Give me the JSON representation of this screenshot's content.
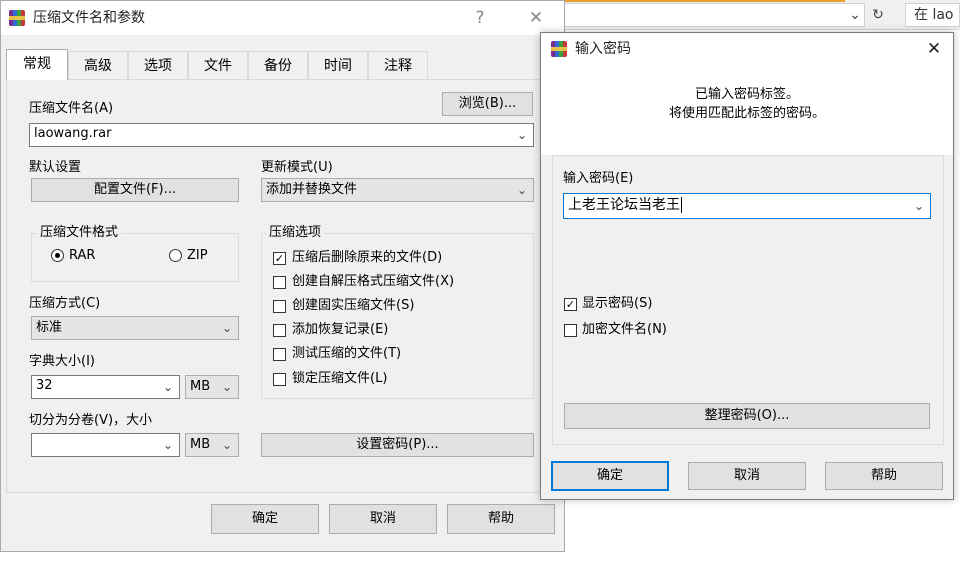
{
  "browser": {
    "search_text": "在 lao",
    "dropdown_icon": "chevron-down-icon",
    "refresh_icon": "refresh-icon"
  },
  "main_dialog": {
    "title": "压缩文件名和参数",
    "help_button": "?",
    "close_button": "✕",
    "tabs": [
      "常规",
      "高级",
      "选项",
      "文件",
      "备份",
      "时间",
      "注释"
    ],
    "archive_name_label": "压缩文件名(A)",
    "archive_name_value": "laowang.rar",
    "browse_button": "浏览(B)...",
    "default_settings_label": "默认设置",
    "profiles_button": "配置文件(F)...",
    "update_mode_label": "更新模式(U)",
    "update_mode_value": "添加并替换文件",
    "archive_format": {
      "title": "压缩文件格式",
      "options": [
        {
          "label": "RAR",
          "selected": true
        },
        {
          "label": "ZIP",
          "selected": false
        }
      ]
    },
    "archive_options": {
      "title": "压缩选项",
      "items": [
        {
          "label": "压缩后删除原来的文件(D)",
          "checked": true
        },
        {
          "label": "创建自解压格式压缩文件(X)",
          "checked": false
        },
        {
          "label": "创建固实压缩文件(S)",
          "checked": false
        },
        {
          "label": "添加恢复记录(E)",
          "checked": false
        },
        {
          "label": "测试压缩的文件(T)",
          "checked": false
        },
        {
          "label": "锁定压缩文件(L)",
          "checked": false
        }
      ]
    },
    "method_label": "压缩方式(C)",
    "method_value": "标准",
    "dict_label": "字典大小(I)",
    "dict_value": "32",
    "dict_unit": "MB",
    "split_label": "切分为分卷(V)，大小",
    "split_value": "",
    "split_unit": "MB",
    "set_password_button": "设置密码(P)...",
    "ok_button": "确定",
    "cancel_button": "取消",
    "help_bottom_button": "帮助"
  },
  "password_dialog": {
    "title": "输入密码",
    "close_button": "✕",
    "info_line1": "已输入密码标签。",
    "info_line2": "将使用匹配此标签的密码。",
    "password_label": "输入密码(E)",
    "password_value": "上老王论坛当老王",
    "show_password": {
      "label": "显示密码(S)",
      "checked": true
    },
    "encrypt_names": {
      "label": "加密文件名(N)",
      "checked": false
    },
    "organize_button": "整理密码(O)...",
    "ok_button": "确定",
    "cancel_button": "取消",
    "help_button": "帮助"
  }
}
